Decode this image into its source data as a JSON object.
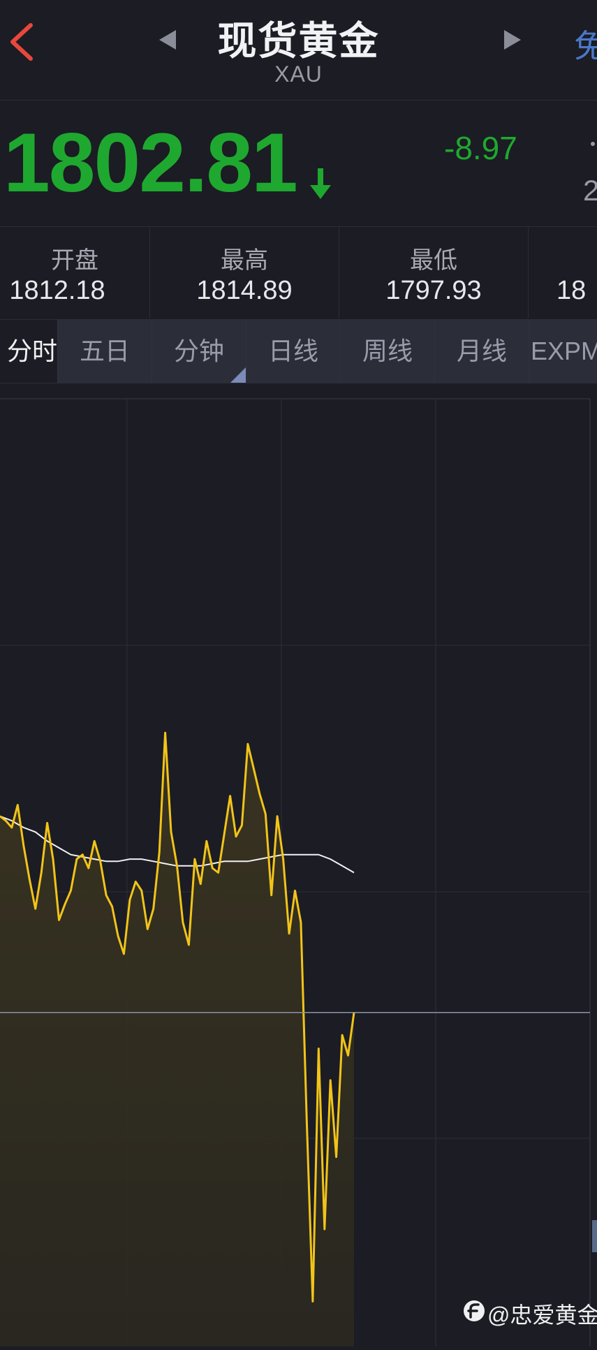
{
  "header": {
    "title": "现货黄金",
    "subtitle": "XAU",
    "right_partial": "免"
  },
  "quote": {
    "price": "1802.81",
    "change": "-8.97",
    "right_partial": "2"
  },
  "stats": [
    {
      "label": "开盘",
      "value": "1812.18"
    },
    {
      "label": "最高",
      "value": "1814.89"
    },
    {
      "label": "最低",
      "value": "1797.93"
    },
    {
      "label": "",
      "value": "18"
    }
  ],
  "tabs": [
    {
      "label": "分时"
    },
    {
      "label": "五日"
    },
    {
      "label": "分钟"
    },
    {
      "label": "日线"
    },
    {
      "label": "周线"
    },
    {
      "label": "月线"
    },
    {
      "label": "EXPM"
    }
  ],
  "colors": {
    "price_down": "#1fa82f",
    "line": "#f2c418",
    "avg": "#f2f2f5",
    "back": "#e8473b",
    "accent": "#4a78c8"
  },
  "chart_data": {
    "type": "line",
    "series": [
      {
        "x": [
          0,
          10,
          20,
          30,
          40,
          50,
          60,
          70,
          80,
          90,
          100,
          110,
          120,
          130,
          140,
          150,
          160,
          170,
          180,
          190,
          200,
          210,
          220,
          230,
          240,
          250,
          260,
          270,
          280,
          290,
          300,
          310,
          320,
          330,
          340,
          350,
          360,
          370,
          380,
          390,
          400,
          410,
          420,
          430,
          440,
          450,
          460,
          470,
          480,
          490,
          500,
          510,
          520,
          530,
          540,
          550,
          560,
          570,
          580,
          590,
          600
        ],
        "values": [
          1811.5,
          1811.3,
          1811.0,
          1812.0,
          1810.2,
          1808.7,
          1807.4,
          1809.0,
          1811.2,
          1809.6,
          1806.9,
          1807.6,
          1808.2,
          1809.6,
          1809.8,
          1809.2,
          1810.4,
          1809.5,
          1808.0,
          1807.5,
          1806.2,
          1805.4,
          1807.8,
          1808.6,
          1808.2,
          1806.5,
          1807.4,
          1809.9,
          1815.2,
          1810.8,
          1809.3,
          1806.8,
          1805.8,
          1809.6,
          1808.5,
          1810.4,
          1809.2,
          1809.0,
          1810.7,
          1812.4,
          1810.6,
          1811.1,
          1814.7,
          1813.6,
          1812.5,
          1811.6,
          1808.0,
          1811.5,
          1809.6,
          1806.3,
          1808.2,
          1806.8,
          1797.9,
          1790.0,
          1801.2,
          1793.2,
          1799.8,
          1796.4,
          1801.8,
          1800.9,
          1802.8
        ]
      },
      {
        "x": [
          0,
          20,
          40,
          60,
          80,
          100,
          120,
          140,
          160,
          180,
          200,
          220,
          240,
          260,
          280,
          300,
          320,
          340,
          360,
          380,
          400,
          420,
          440,
          460,
          480,
          500,
          520,
          540,
          560,
          580,
          600
        ],
        "values": [
          1811.5,
          1811.3,
          1811.0,
          1810.8,
          1810.4,
          1810.1,
          1809.8,
          1809.7,
          1809.6,
          1809.5,
          1809.5,
          1809.6,
          1809.6,
          1809.5,
          1809.4,
          1809.3,
          1809.3,
          1809.3,
          1809.4,
          1809.5,
          1809.5,
          1809.5,
          1809.6,
          1809.7,
          1809.8,
          1809.8,
          1809.8,
          1809.8,
          1809.6,
          1809.3,
          1809.0
        ]
      }
    ],
    "ylim": [
      1788,
      1830
    ],
    "xlim": [
      0,
      1000
    ],
    "grid": true
  }
}
